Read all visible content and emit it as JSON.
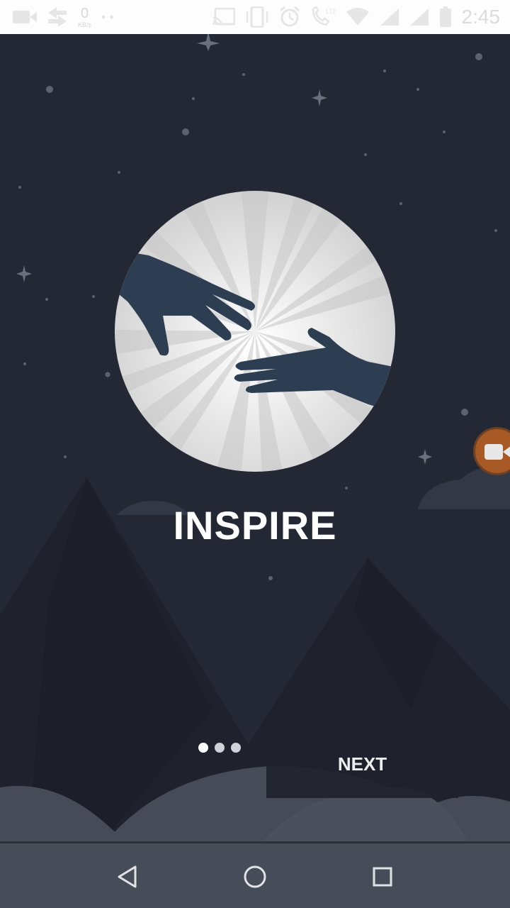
{
  "status_bar": {
    "time": "2:45",
    "net_speed_value": "0",
    "net_speed_unit": "KB/s",
    "left_icons": [
      "video-camera-icon",
      "sync-arrows-icon",
      "network-speed-icon",
      "overflow-dots-icon"
    ],
    "right_icons": [
      "cast-icon",
      "vibrate-icon",
      "alarm-icon",
      "volte-call-icon",
      "wifi-icon",
      "signal-icon",
      "signal-icon",
      "battery-icon"
    ]
  },
  "onboarding": {
    "title": "INSPIRE",
    "page_count": 3,
    "active_page": 1,
    "next_label": "NEXT"
  },
  "colors": {
    "background": "#242835",
    "mountain": "#1f222d",
    "illustration_circle": "#e6e6e6",
    "hands": "#2e3e52",
    "nav_bar": "#474d58",
    "status_bar": "#fdfdfd",
    "floating_button": "#a85a26"
  },
  "nav_bar": {
    "buttons": [
      "back-icon",
      "home-icon",
      "recents-icon"
    ]
  }
}
